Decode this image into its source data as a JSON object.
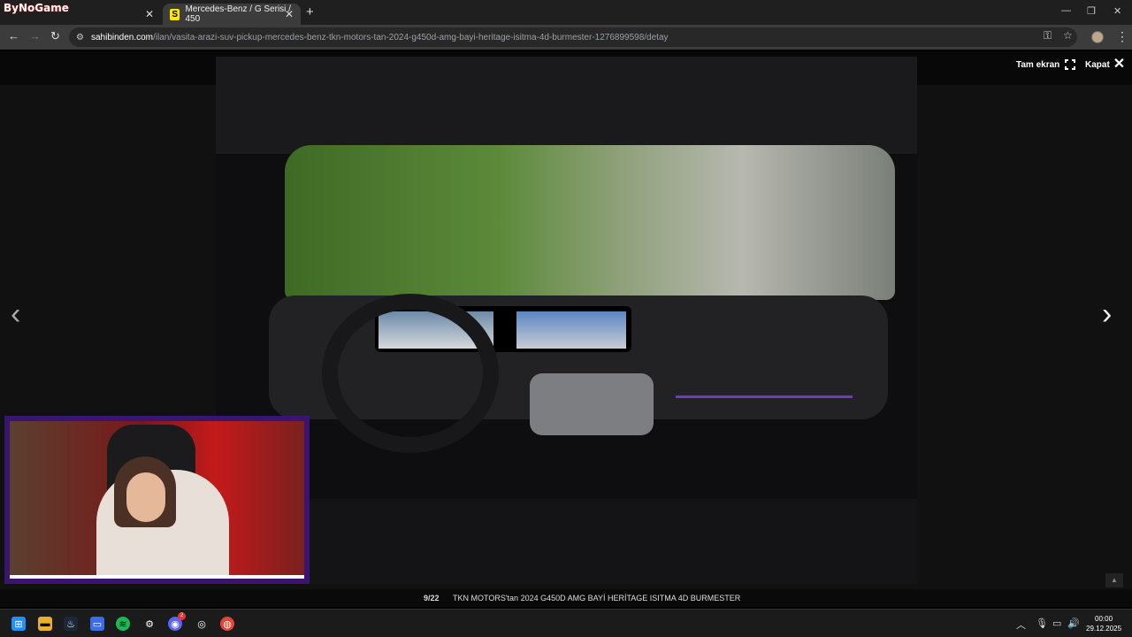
{
  "overlay": {
    "brand": "ByNoGame"
  },
  "browser": {
    "tabs": [
      {
        "label": ""
      },
      {
        "label": "Mercedes-Benz / G Serisi / 450"
      }
    ],
    "url_host": "sahibinden.com",
    "url_path": "/ilan/vasita-arazi-suv-pickup-mercedes-benz-tkn-motors-tan-2024-g450d-amg-bayi-heritage-isitma-4d-burmester-1276899598/detay"
  },
  "viewer": {
    "listing_id": "#1276899598",
    "fullscreen_label": "Tam ekran",
    "close_label": "Kapat",
    "counter": "9/22",
    "caption": "TKN MOTORS'tan 2024 G450D AMG BAYİ HERİTAGE ISITMA 4D BURMESTER"
  },
  "taskbar": {
    "clock_time": "00:00",
    "clock_date": "29.12.2025",
    "discord_badge": "2"
  },
  "colors": {
    "accent_yellow": "#ffe800",
    "webcam_frame": "#3a1570"
  }
}
